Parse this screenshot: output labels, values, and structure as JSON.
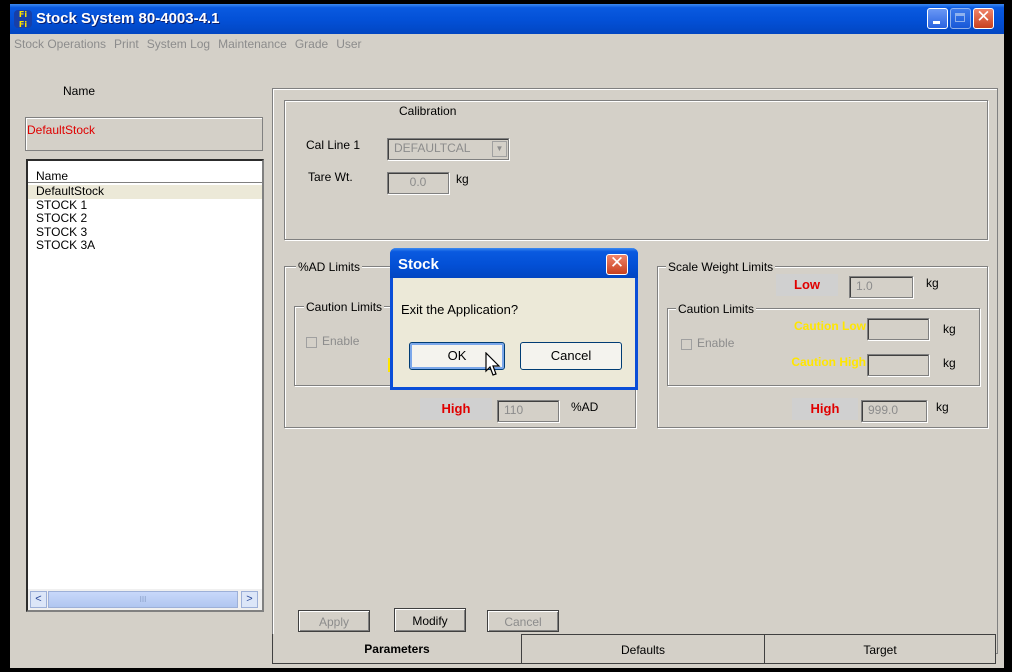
{
  "window": {
    "title": "Stock System 80-4003-4.1",
    "icon": "app-globe-icon"
  },
  "menu": {
    "items": [
      "Stock Operations",
      "Print",
      "System Log",
      "Maintenance",
      "Grade",
      "User"
    ]
  },
  "left": {
    "name_label": "Name",
    "name_value": "DefaultStock",
    "list_header": "Name",
    "list_items": [
      "DefaultStock",
      "STOCK 1",
      "STOCK 2",
      "STOCK 3",
      "STOCK 3A"
    ],
    "selected_index": 0,
    "scroll_thumb": "III"
  },
  "calibration": {
    "title": "Calibration",
    "cal_line_label": "Cal Line 1",
    "cal_line_value": "DEFAULTCAL",
    "tare_label": "Tare Wt.",
    "tare_value": "0.0",
    "tare_unit": "kg"
  },
  "ad_limits": {
    "title": "%AD  Limits",
    "caution_title": "Caution Limits",
    "enable_label": "Enable",
    "high_label": "High",
    "high_value": "110",
    "high_unit": "%AD"
  },
  "scale_limits": {
    "title": "Scale Weight Limits",
    "low_label": "Low",
    "low_value": "1.0",
    "low_unit": "kg",
    "caution_title": "Caution Limits",
    "enable_label": "Enable",
    "caution_low_label": "Caution Low",
    "caution_low_unit": "kg",
    "caution_high_label": "Caution High",
    "caution_high_unit": "kg",
    "high_label": "High",
    "high_value": "999.0",
    "high_unit": "kg"
  },
  "actions": {
    "apply": "Apply",
    "modify": "Modify",
    "cancel": "Cancel"
  },
  "tabs": [
    "Parameters",
    "Defaults",
    "Target"
  ],
  "dialog": {
    "title": "Stock",
    "message": "Exit the Application?",
    "ok": "OK",
    "cancel": "Cancel"
  },
  "colors": {
    "titlebar": "#0350d6",
    "error_red": "#e00000",
    "caution_yellow": "#ffe600"
  }
}
